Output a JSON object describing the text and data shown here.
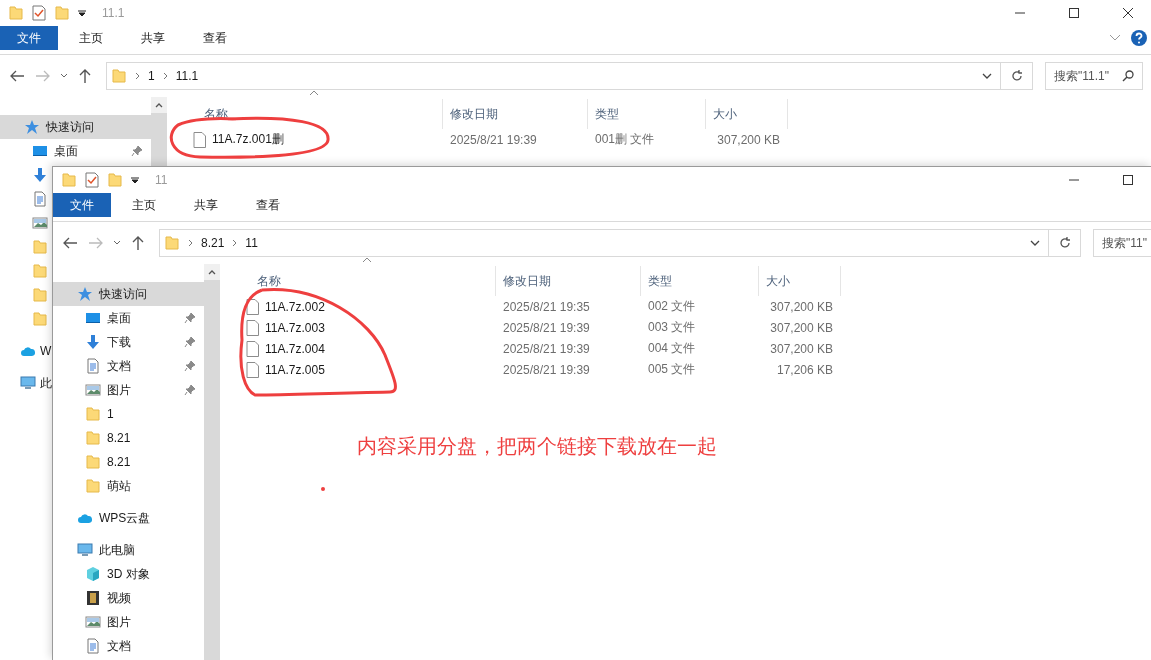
{
  "windows": [
    {
      "title": "11.1",
      "ribbon_tabs": [
        {
          "label": "文件",
          "selected": true
        },
        {
          "label": "主页",
          "selected": false
        },
        {
          "label": "共享",
          "selected": false
        },
        {
          "label": "查看",
          "selected": false
        }
      ],
      "path": [
        "1",
        "11.1"
      ],
      "search": {
        "placeholder": "搜索\"11.1\""
      },
      "columns": [
        "名称",
        "修改日期",
        "类型",
        "大小"
      ],
      "files": [
        {
          "name": "11A.7z.001删",
          "modified": "2025/8/21 19:39",
          "type": "001删 文件",
          "size": "307,200 KB"
        }
      ],
      "nav": [
        {
          "label": "快速访问",
          "selected": true,
          "children": [
            {
              "label": "桌面",
              "pinned": true
            }
          ]
        },
        {
          "label": "W",
          "selected": false
        },
        {
          "label": "此",
          "selected": false
        }
      ]
    },
    {
      "title": "11",
      "ribbon_tabs": [
        {
          "label": "文件",
          "selected": true
        },
        {
          "label": "主页",
          "selected": false
        },
        {
          "label": "共享",
          "selected": false
        },
        {
          "label": "查看",
          "selected": false
        }
      ],
      "path": [
        "8.21",
        "11"
      ],
      "search": {
        "placeholder": "搜索\"11\""
      },
      "columns": [
        "名称",
        "修改日期",
        "类型",
        "大小"
      ],
      "files": [
        {
          "name": "11A.7z.002",
          "modified": "2025/8/21 19:35",
          "type": "002 文件",
          "size": "307,200 KB"
        },
        {
          "name": "11A.7z.003",
          "modified": "2025/8/21 19:39",
          "type": "003 文件",
          "size": "307,200 KB"
        },
        {
          "name": "11A.7z.004",
          "modified": "2025/8/21 19:39",
          "type": "004 文件",
          "size": "307,200 KB"
        },
        {
          "name": "11A.7z.005",
          "modified": "2025/8/21 19:39",
          "type": "005 文件",
          "size": "17,206 KB"
        }
      ],
      "nav": [
        {
          "label": "快速访问",
          "selected": true,
          "children": [
            {
              "label": "桌面",
              "pinned": true
            },
            {
              "label": "下载",
              "pinned": true
            },
            {
              "label": "文档",
              "pinned": true
            },
            {
              "label": "图片",
              "pinned": true
            },
            {
              "label": "1",
              "pinned": false
            },
            {
              "label": "8.21",
              "pinned": false
            },
            {
              "label": "8.21",
              "pinned": false
            },
            {
              "label": "萌站",
              "pinned": false
            }
          ]
        },
        {
          "label": "WPS云盘",
          "selected": false
        },
        {
          "label": "此电脑",
          "selected": false,
          "children": [
            {
              "label": "3D 对象"
            },
            {
              "label": "视频"
            },
            {
              "label": "图片"
            },
            {
              "label": "文档"
            }
          ]
        }
      ]
    }
  ],
  "annotation": {
    "note": "内容采用分盘，把两个链接下载放在一起"
  }
}
